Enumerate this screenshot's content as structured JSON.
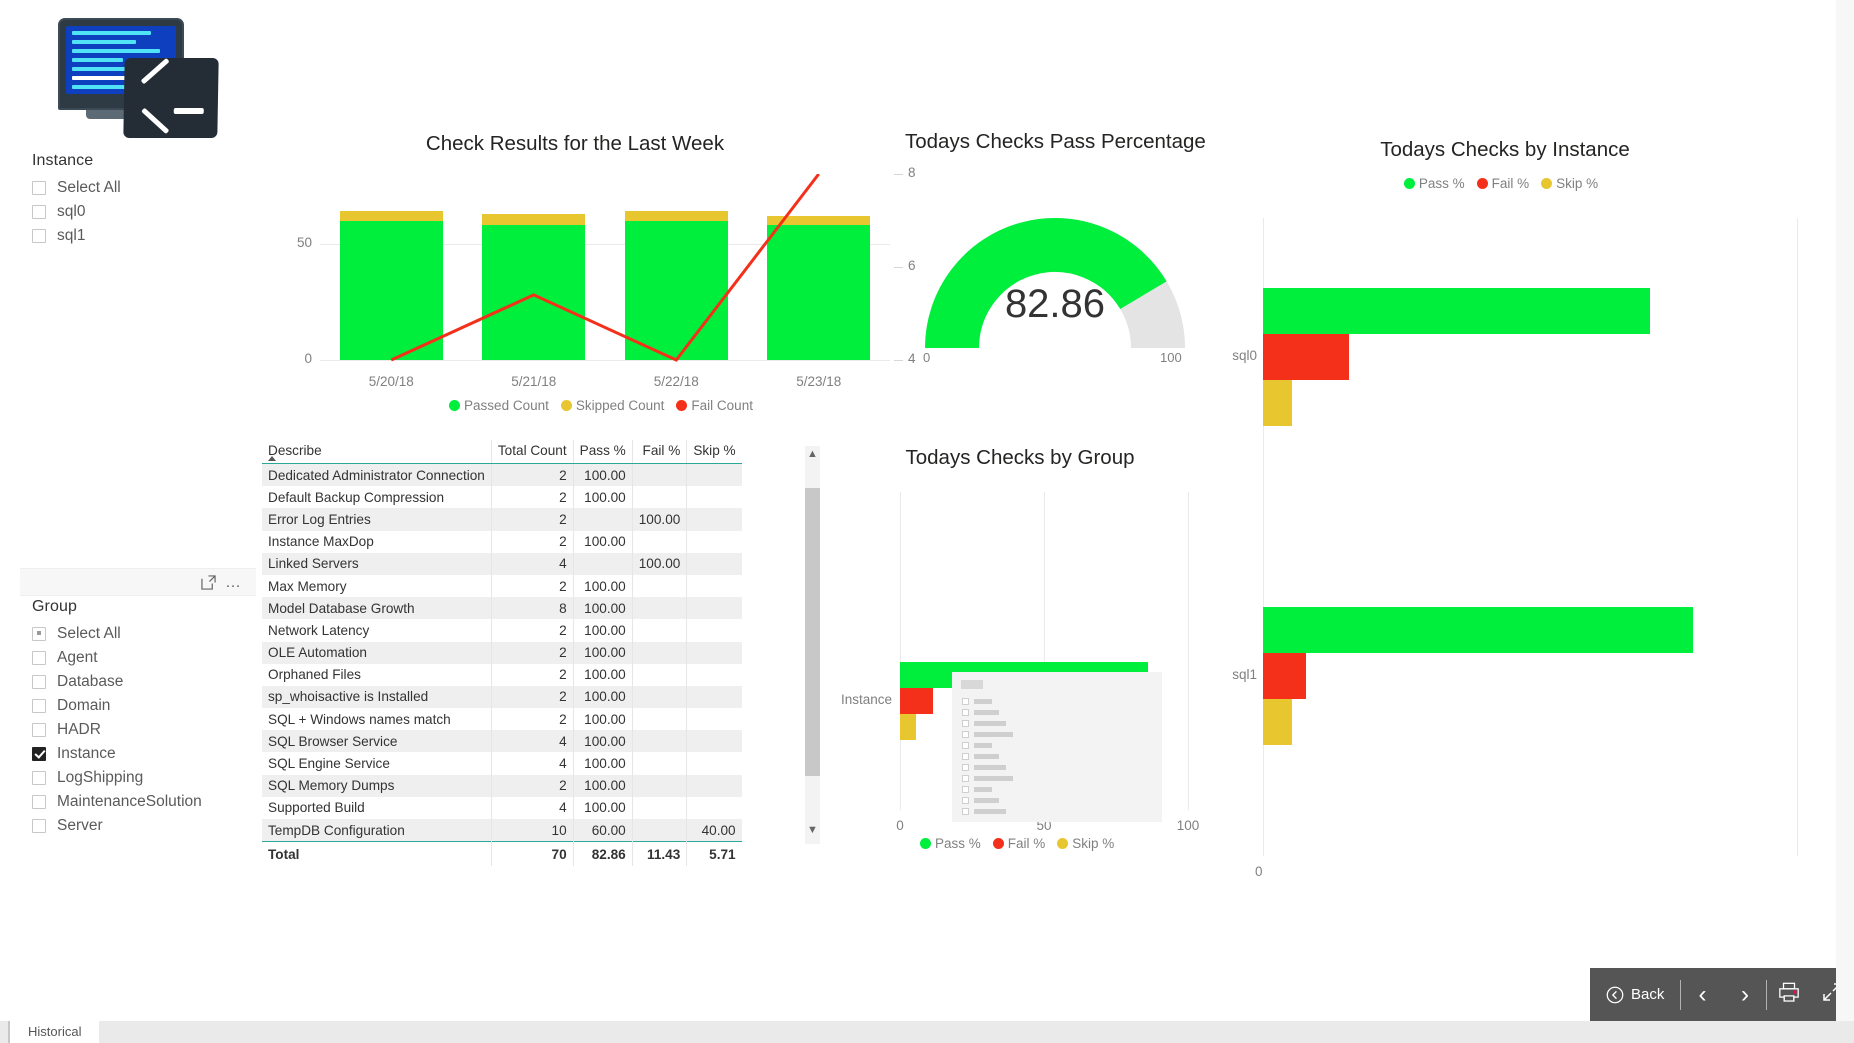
{
  "app": {
    "tab_label": "Historical"
  },
  "slicers": {
    "instance": {
      "title": "Instance",
      "items": [
        {
          "label": "Select All",
          "state": "unchecked"
        },
        {
          "label": "sql0",
          "state": "unchecked"
        },
        {
          "label": "sql1",
          "state": "unchecked"
        }
      ]
    },
    "group": {
      "title": "Group",
      "items": [
        {
          "label": "Select All",
          "state": "partial"
        },
        {
          "label": "Agent",
          "state": "unchecked"
        },
        {
          "label": "Database",
          "state": "unchecked"
        },
        {
          "label": "Domain",
          "state": "unchecked"
        },
        {
          "label": "HADR",
          "state": "unchecked"
        },
        {
          "label": "Instance",
          "state": "checked"
        },
        {
          "label": "LogShipping",
          "state": "unchecked"
        },
        {
          "label": "MaintenanceSolution",
          "state": "unchecked"
        },
        {
          "label": "Server",
          "state": "unchecked"
        }
      ]
    }
  },
  "colors": {
    "pass": "#00ee3c",
    "fail": "#f4301a",
    "skip": "#e8c62f",
    "line": "#fa3c1e",
    "gauge_track": "#e4e4e4",
    "accent": "#2aa99a"
  },
  "chart_data": [
    {
      "id": "combo",
      "type": "bar",
      "title": "Check Results for the Last Week",
      "categories": [
        "5/20/18",
        "5/21/18",
        "5/22/18",
        "5/23/18"
      ],
      "series": [
        {
          "name": "Passed Count",
          "color": "#00ee3c",
          "values": [
            60,
            58,
            60,
            58
          ]
        },
        {
          "name": "Skipped Count",
          "color": "#e8c62f",
          "values": [
            4,
            5,
            4,
            4
          ]
        },
        {
          "name": "Fail Count",
          "color": "#f4301a",
          "type": "line",
          "values": [
            4,
            5.4,
            4,
            8
          ]
        }
      ],
      "ylabel": "",
      "xlabel": "",
      "yticks": [
        "0",
        "50"
      ],
      "ylim": [
        0,
        80
      ],
      "y2ticks": [
        "4",
        "6",
        "8"
      ],
      "y2lim": [
        4,
        8
      ],
      "legend": [
        "Passed Count",
        "Skipped Count",
        "Fail Count"
      ],
      "legend_position": "bottom",
      "grid": true
    },
    {
      "id": "gauge",
      "type": "gauge",
      "title": "Todays Checks Pass Percentage",
      "value": "82.86",
      "min": "0",
      "max": "100"
    },
    {
      "id": "by-instance",
      "type": "bar",
      "title": "Todays Checks by Instance",
      "orientation": "horizontal",
      "categories": [
        "sql0",
        "sql1"
      ],
      "series": [
        {
          "name": "Pass %",
          "color": "#00ee3c",
          "values": [
            77.14,
            85.71
          ]
        },
        {
          "name": "Fail %",
          "color": "#f4301a",
          "values": [
            17.14,
            8.57
          ]
        },
        {
          "name": "Skip %",
          "color": "#e8c62f",
          "values": [
            5.71,
            5.71
          ]
        }
      ],
      "xticks": [
        "0"
      ],
      "xlim": [
        0,
        100
      ],
      "legend": [
        "Pass %",
        "Fail %",
        "Skip %"
      ],
      "legend_position": "top",
      "grid": true
    },
    {
      "id": "by-group",
      "type": "bar",
      "title": "Todays Checks by Group",
      "orientation": "horizontal",
      "categories": [
        "Instance"
      ],
      "series": [
        {
          "name": "Pass %",
          "color": "#00ee3c",
          "values": [
            86
          ]
        },
        {
          "name": "Fail %",
          "color": "#f4301a",
          "values": [
            11.4
          ]
        },
        {
          "name": "Skip %",
          "color": "#e8c62f",
          "values": [
            5.7
          ]
        }
      ],
      "xticks": [
        "0",
        "50",
        "100"
      ],
      "xlim": [
        0,
        100
      ],
      "legend": [
        "Pass %",
        "Fail %",
        "Skip %"
      ],
      "legend_position": "bottom",
      "grid": true
    }
  ],
  "table": {
    "columns": [
      "Describe",
      "Total Count",
      "Pass %",
      "Fail %",
      "Skip %"
    ],
    "sort_column": "Describe",
    "sort_direction": "asc",
    "rows": [
      [
        "Dedicated Administrator Connection",
        "2",
        "100.00",
        "",
        ""
      ],
      [
        "Default Backup Compression",
        "2",
        "100.00",
        "",
        ""
      ],
      [
        "Error Log Entries",
        "2",
        "",
        "100.00",
        ""
      ],
      [
        "Instance MaxDop",
        "2",
        "100.00",
        "",
        ""
      ],
      [
        "Linked Servers",
        "4",
        "",
        "100.00",
        ""
      ],
      [
        "Max Memory",
        "2",
        "100.00",
        "",
        ""
      ],
      [
        "Model Database Growth",
        "8",
        "100.00",
        "",
        ""
      ],
      [
        "Network Latency",
        "2",
        "100.00",
        "",
        ""
      ],
      [
        "OLE Automation",
        "2",
        "100.00",
        "",
        ""
      ],
      [
        "Orphaned Files",
        "2",
        "100.00",
        "",
        ""
      ],
      [
        "sp_whoisactive is Installed",
        "2",
        "100.00",
        "",
        ""
      ],
      [
        "SQL + Windows names match",
        "2",
        "100.00",
        "",
        ""
      ],
      [
        "SQL Browser Service",
        "4",
        "100.00",
        "",
        ""
      ],
      [
        "SQL Engine Service",
        "4",
        "100.00",
        "",
        ""
      ],
      [
        "SQL Memory Dumps",
        "2",
        "100.00",
        "",
        ""
      ],
      [
        "Supported Build",
        "4",
        "100.00",
        "",
        ""
      ],
      [
        "TempDB Configuration",
        "10",
        "60.00",
        "",
        "40.00"
      ]
    ],
    "total_row": [
      "Total",
      "70",
      "82.86",
      "11.43",
      "5.71"
    ]
  },
  "nav": {
    "back_label": "Back",
    "prev_icon": "chevron-left-icon",
    "next_icon": "chevron-right-icon",
    "print_icon": "print-icon",
    "expand_icon": "expand-icon"
  }
}
